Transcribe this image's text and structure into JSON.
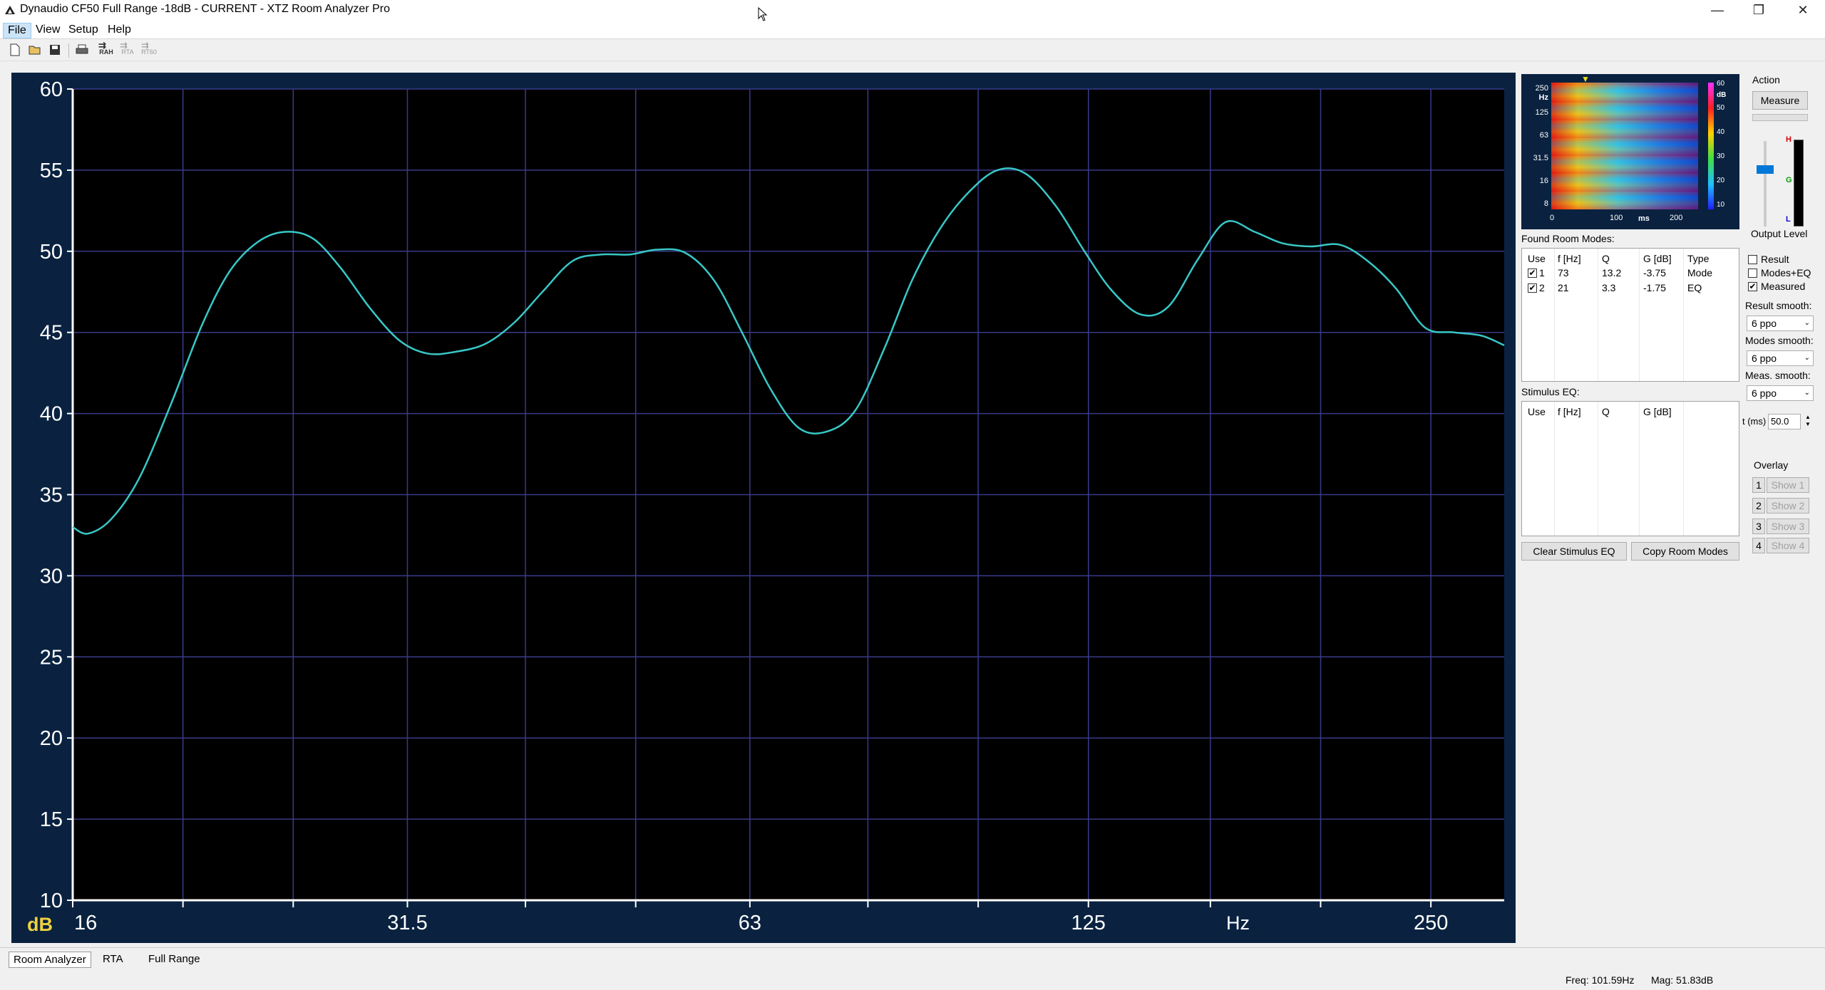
{
  "window": {
    "title": "Dynaudio CF50 Full Range -18dB - CURRENT - XTZ Room Analyzer Pro",
    "min": "—",
    "max": "❐",
    "close": "✕"
  },
  "menu": [
    "File",
    "View",
    "Setup",
    "Help"
  ],
  "toolbar": {
    "rah": "RAH",
    "rta": "RTA",
    "rt60": "RT60"
  },
  "chart_data": {
    "type": "line",
    "ylabel": "dB",
    "xlabel": "Hz",
    "ylim": [
      10,
      60
    ],
    "xlim": [
      16,
      290
    ],
    "xscale": "log",
    "yticks": [
      "60",
      "55",
      "50",
      "45",
      "40",
      "35",
      "30",
      "25",
      "20",
      "15",
      "10"
    ],
    "xticks": [
      "16",
      "31.5",
      "63",
      "125",
      "250"
    ],
    "series": [
      {
        "color": "#38c8c8",
        "x": [
          16,
          16.5,
          17.3,
          18.3,
          19.5,
          20.8,
          22,
          23.3,
          24.6,
          26,
          27.5,
          29.2,
          31,
          32.8,
          34.7,
          36.9,
          39.1,
          41.4,
          44,
          46.6,
          49.4,
          52.2,
          55.3,
          58.6,
          62,
          65.7,
          69.6,
          73.7,
          78,
          82.7,
          87.6,
          92.8,
          98.3,
          104,
          110,
          117,
          124,
          131,
          139,
          147,
          156,
          165,
          175,
          185,
          196,
          208,
          220,
          233,
          247,
          262,
          277,
          290
        ],
        "y": [
          33,
          32.6,
          33.5,
          36,
          40.5,
          45.5,
          48.8,
          50.6,
          51.2,
          50.8,
          49,
          46.5,
          44.5,
          43.7,
          43.8,
          44.3,
          45.6,
          47.5,
          49.4,
          49.8,
          49.8,
          50.1,
          49.9,
          48.2,
          45,
          41.5,
          39.1,
          38.9,
          40.2,
          44,
          48.3,
          51.5,
          53.7,
          55,
          54.8,
          52.8,
          50,
          47.6,
          46.1,
          46.6,
          49.5,
          51.8,
          51.2,
          50.5,
          50.3,
          50.4,
          49.4,
          47.7,
          45.3,
          45,
          44.8,
          44.2
        ]
      }
    ]
  },
  "spectrogram": {
    "y_labels": [
      "250",
      "Hz",
      "125",
      "63",
      "31.5",
      "16",
      "8"
    ],
    "x_labels": [
      "0",
      "100",
      "ms",
      "200"
    ],
    "scale_labels": [
      "dB",
      "60",
      "50",
      "40",
      "30",
      "20",
      "10"
    ],
    "marker": "▼"
  },
  "action": {
    "title": "Action",
    "measure": "Measure",
    "output_level": "Output Level",
    "meter_h": "H",
    "meter_g": "G",
    "meter_l": "L"
  },
  "found_modes": {
    "title": "Found Room Modes:",
    "headers": [
      "Use",
      "f [Hz]",
      "Q",
      "G [dB]",
      "Type"
    ],
    "rows": [
      {
        "checked": "✔",
        "n": "1",
        "f": "73",
        "q": "13.2",
        "g": "-3.75",
        "type": "Mode"
      },
      {
        "checked": "✔",
        "n": "2",
        "f": "21",
        "q": "3.3",
        "g": "-1.75",
        "type": "EQ"
      }
    ]
  },
  "stimulus_eq": {
    "title": "Stimulus EQ:",
    "headers": [
      "Use",
      "f [Hz]",
      "Q",
      "G [dB]"
    ]
  },
  "buttons": {
    "clear": "Clear Stimulus EQ",
    "copy": "Copy Room Modes"
  },
  "options": {
    "result": "Result",
    "modes_eq": "Modes+EQ",
    "measured": "Measured",
    "measured_checked": "✔",
    "result_smooth_label": "Result smooth:",
    "result_smooth": "6 ppo",
    "modes_smooth_label": "Modes smooth:",
    "modes_smooth": "6 ppo",
    "meas_smooth_label": "Meas. smooth:",
    "meas_smooth": "6 ppo",
    "t_label": "t (ms)",
    "t_value": "50.0"
  },
  "overlay": {
    "title": "Overlay",
    "items": [
      {
        "n": "1",
        "label": "Show 1"
      },
      {
        "n": "2",
        "label": "Show 2"
      },
      {
        "n": "3",
        "label": "Show 3"
      },
      {
        "n": "4",
        "label": "Show 4"
      }
    ]
  },
  "tabs": [
    "Room Analyzer",
    "RTA",
    "Full Range"
  ],
  "status": {
    "freq": "Freq: 101.59Hz",
    "mag": "Mag: 51.83dB"
  }
}
